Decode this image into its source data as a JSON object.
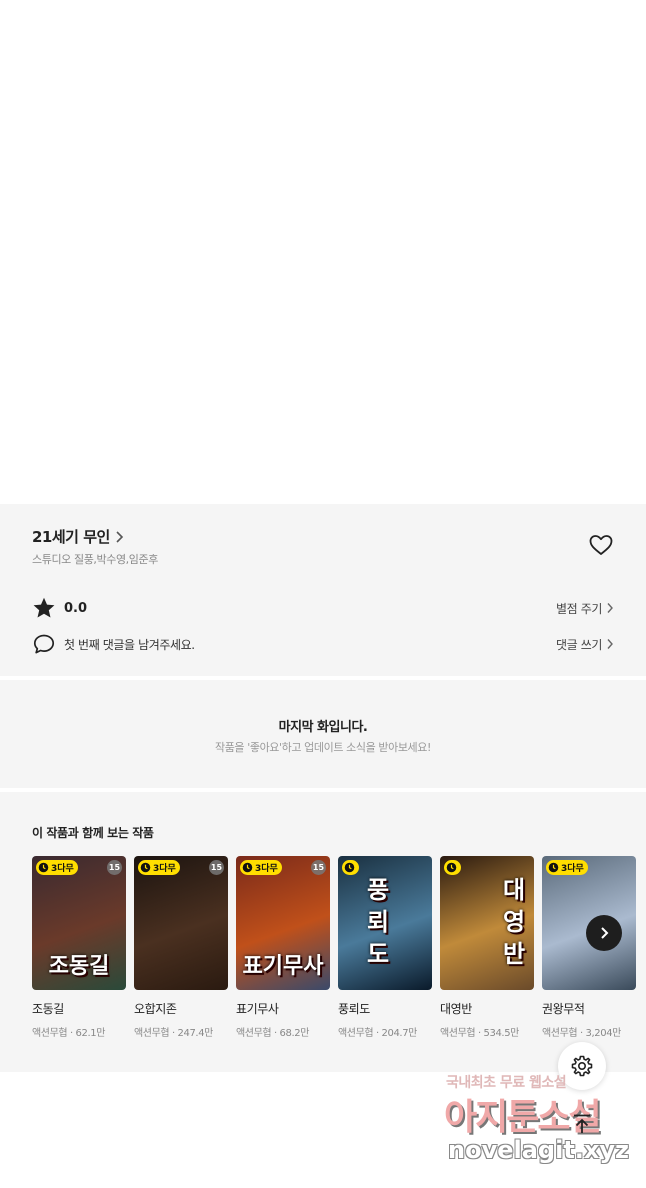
{
  "work": {
    "title": "21세기 무인",
    "authors": "스튜디오 질풍,박수영,임준후",
    "rating": "0.0",
    "rate_action": "별점 주기",
    "comment_prompt": "첫 번째 댓글을 남겨주세요.",
    "comment_action": "댓글 쓰기"
  },
  "last_episode": {
    "title": "마지막 화입니다.",
    "subtitle": "작품을 '좋아요'하고 업데이트 소식을 받아보세요!"
  },
  "recommendations": {
    "heading": "이 작품과 함께 보는 작품",
    "items": [
      {
        "title": "조동길",
        "meta": "액션무협 · 62.1만",
        "badge": "3다무",
        "age": "15",
        "cover_text": "조동길",
        "colors": [
          "#3a2a30",
          "#6a3a2a",
          "#2a4a3a"
        ]
      },
      {
        "title": "오합지존",
        "meta": "액션무협 · 247.4만",
        "badge": "3다무",
        "age": "15",
        "cover_text": "",
        "colors": [
          "#1c1410",
          "#4a3020",
          "#2a1a10"
        ]
      },
      {
        "title": "표기무사",
        "meta": "액션무협 · 68.2만",
        "badge": "3다무",
        "age": "15",
        "cover_text": "표기무사",
        "colors": [
          "#7a2a1a",
          "#c0501a",
          "#3a4a6a"
        ]
      },
      {
        "title": "풍뢰도",
        "meta": "액션무협 · 204.7만",
        "badge": "",
        "age": "",
        "cover_text": "풍뢰도",
        "colors": [
          "#1a3040",
          "#4a7a9a",
          "#0a1a2a"
        ]
      },
      {
        "title": "대영반",
        "meta": "액션무협 · 534.5만",
        "badge": "",
        "age": "",
        "cover_text": "대영반",
        "colors": [
          "#2a1a10",
          "#c08a3a",
          "#6a4a2a"
        ]
      },
      {
        "title": "권왕무적",
        "meta": "액션무협 · 3,204만",
        "badge": "3다무",
        "age": "",
        "cover_text": "",
        "colors": [
          "#5a6a7a",
          "#aabacf",
          "#3a4a5a"
        ]
      }
    ]
  },
  "watermark": {
    "line1": "국내최초 무료 웹소설",
    "line2": "아지툰소설",
    "line3": "novelagit.xyz"
  },
  "icons": {
    "heart": "heart-outline-icon",
    "star": "star-icon",
    "comment": "speech-bubble-icon",
    "chevron": "chevron-right-icon",
    "clock": "clock-icon",
    "settings": "gear-icon",
    "top": "arrow-up-top-icon"
  }
}
